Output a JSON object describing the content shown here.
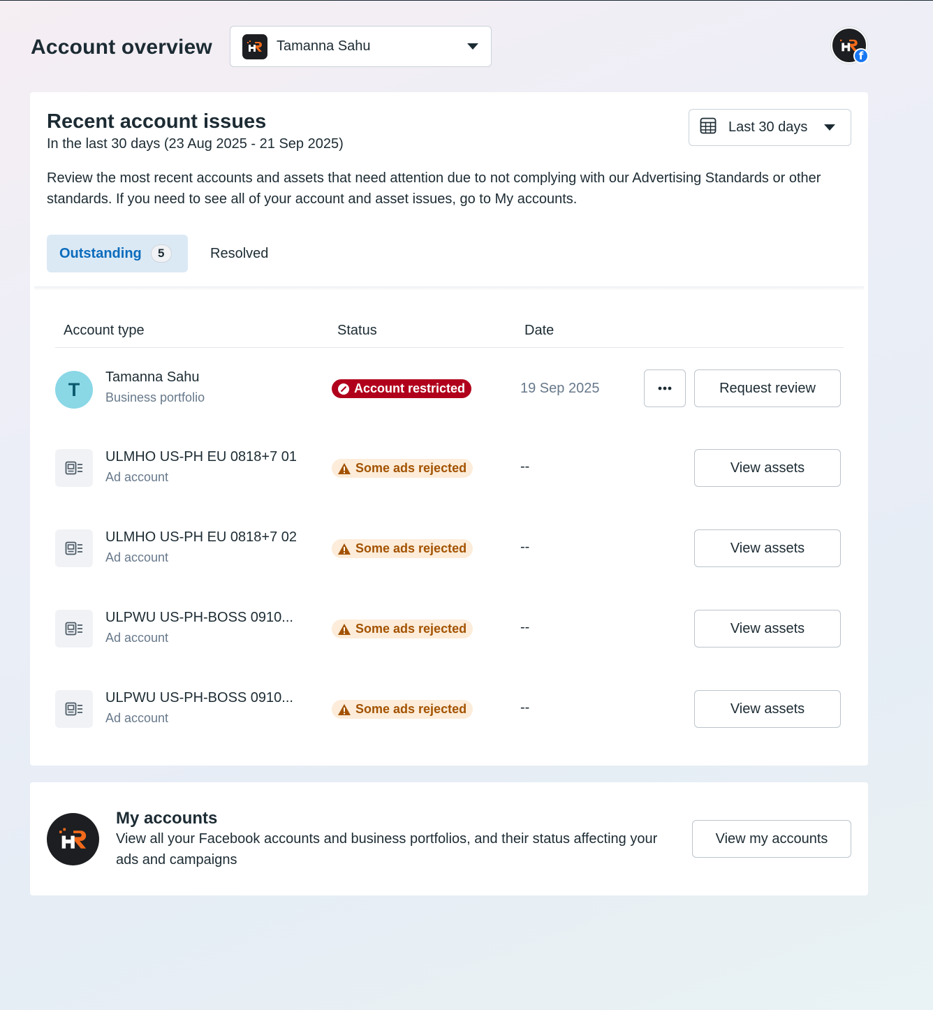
{
  "header": {
    "title": "Account overview",
    "account_selector": {
      "name": "Tamanna Sahu"
    }
  },
  "issues": {
    "title": "Recent account issues",
    "subtitle": "In the last 30 days (23 Aug 2025 - 21 Sep 2025)",
    "description": "Review the most recent accounts and assets that need attention due to not complying with our Advertising Standards or other standards. If you need to see all of your account and asset issues, go to My accounts.",
    "date_range": "Last 30 days",
    "tabs": [
      {
        "label": "Outstanding",
        "count": "5",
        "active": true
      },
      {
        "label": "Resolved"
      }
    ],
    "columns": [
      "Account type",
      "Status",
      "Date"
    ],
    "rows": [
      {
        "name": "Tamanna Sahu",
        "type": "Business portfolio",
        "avatar": "T",
        "status": "Account restricted",
        "status_kind": "restricted",
        "date": "19 Sep 2025",
        "action": "Request review"
      },
      {
        "name": "ULMHO US-PH EU 0818+7 01",
        "type": "Ad account",
        "status": "Some ads rejected",
        "status_kind": "warning",
        "date": "--",
        "action": "View assets"
      },
      {
        "name": "ULMHO US-PH EU 0818+7 02",
        "type": "Ad account",
        "status": "Some ads rejected",
        "status_kind": "warning",
        "date": "--",
        "action": "View assets"
      },
      {
        "name": "ULPWU US-PH-BOSS 0910...",
        "type": "Ad account",
        "status": "Some ads rejected",
        "status_kind": "warning",
        "date": "--",
        "action": "View assets"
      },
      {
        "name": "ULPWU US-PH-BOSS 0910...",
        "type": "Ad account",
        "status": "Some ads rejected",
        "status_kind": "warning",
        "date": "--",
        "action": "View assets"
      }
    ]
  },
  "my_accounts": {
    "title": "My accounts",
    "description": "View all your Facebook accounts and business portfolios, and their status affecting your ads and campaigns",
    "button": "View my accounts"
  },
  "icons": {
    "calendar": "calendar-icon",
    "ad_account": "ad-account-icon",
    "restricted": "restricted-icon",
    "warning": "warning-icon",
    "more": "more-icon",
    "facebook": "facebook-badge-icon"
  },
  "colors": {
    "accent_blue": "#0a6bbc",
    "tab_active_bg": "#dbe9f5",
    "restricted_red": "#b1001c",
    "warning_amber_bg": "#fcecd9",
    "warning_amber_text": "#a35200",
    "facebook_blue": "#1877f2"
  }
}
